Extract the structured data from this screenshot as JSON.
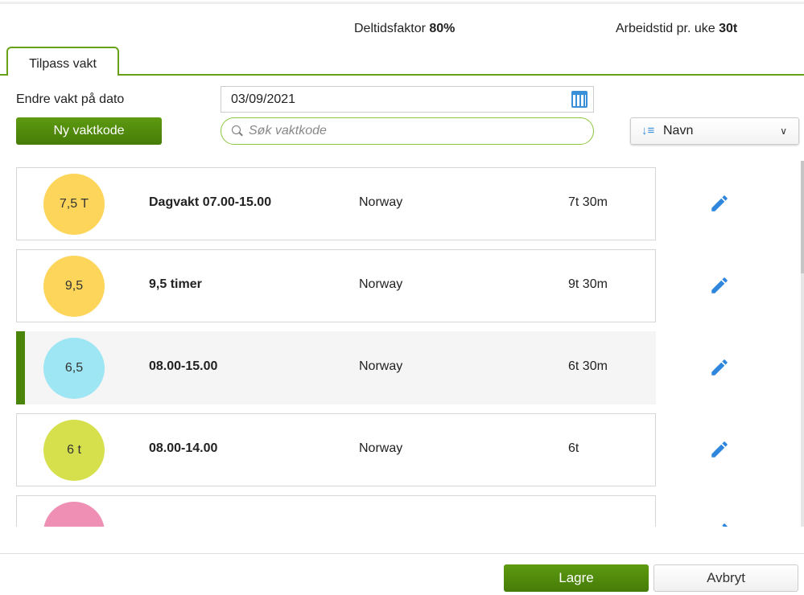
{
  "header": {
    "deltidsfaktor_label": "Deltidsfaktor",
    "deltidsfaktor_value": "80%",
    "arbeidstid_label": "Arbeidstid pr. uke",
    "arbeidstid_value": "30t"
  },
  "tab": {
    "label": "Tilpass vakt"
  },
  "form": {
    "date_label": "Endre vakt på dato",
    "date_value": "03/09/2021",
    "new_button": "Ny vaktkode",
    "search_placeholder": "Søk vaktkode",
    "sort_value": "Navn"
  },
  "rows": [
    {
      "code": "7,5 T",
      "name": "Dagvakt 07.00-15.00",
      "region": "Norway",
      "duration": "7t 30m",
      "color": "#fdd55a"
    },
    {
      "code": "9,5",
      "name": "9,5 timer",
      "region": "Norway",
      "duration": "9t 30m",
      "color": "#fdd55a"
    },
    {
      "code": "6,5",
      "name": "08.00-15.00",
      "region": "Norway",
      "duration": "6t 30m",
      "color": "#9ee6f3",
      "selected": true
    },
    {
      "code": "6 t",
      "name": "08.00-14.00",
      "region": "Norway",
      "duration": "6t",
      "color": "#d6e04c"
    },
    {
      "code": "",
      "name": "",
      "region": "",
      "duration": "",
      "color": "#ee8fb3"
    }
  ],
  "footer": {
    "save": "Lagre",
    "cancel": "Avbryt"
  }
}
